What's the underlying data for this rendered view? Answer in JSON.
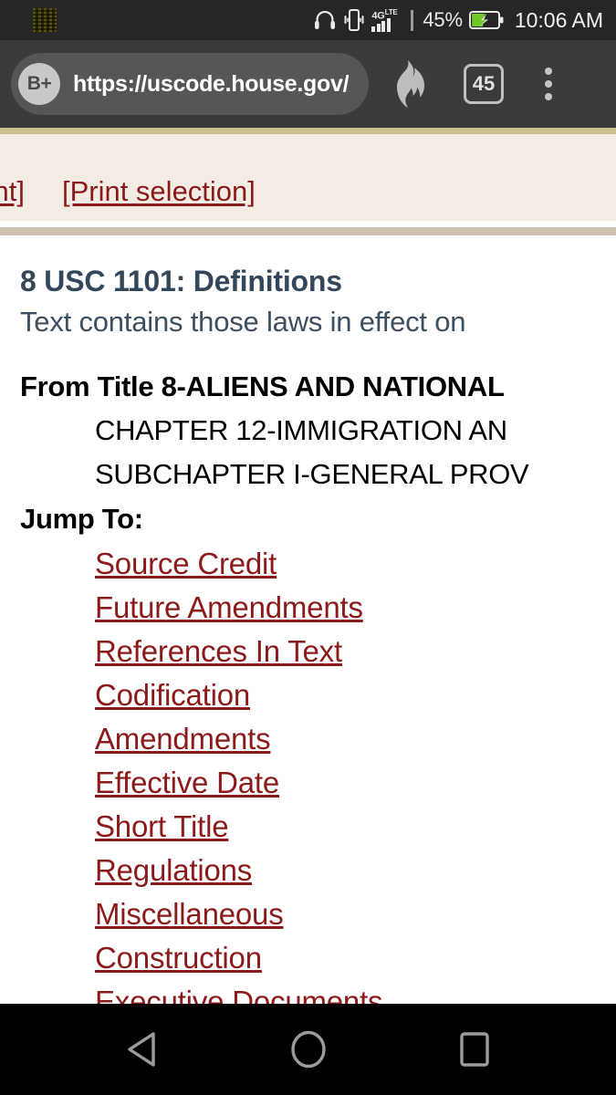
{
  "status_bar": {
    "notification_icon": "app-notification-icon",
    "headphones_icon": "headphones-icon",
    "vibrate_icon": "vibrate-icon",
    "network_label": "4G",
    "network_sup": "LTE",
    "battery_percent": "45%",
    "battery_icon": "battery-charging-icon",
    "clock": "10:06 AM"
  },
  "browser": {
    "bat_badge": "B+",
    "url": "https://uscode.house.gov/",
    "shields_icon": "brave-shields-flame-icon",
    "tab_count": "45",
    "menu_icon": "overflow-menu-icon"
  },
  "page": {
    "print_links": [
      {
        "label": "[Print]"
      },
      {
        "label": "[Print selection]"
      }
    ],
    "doc_title": "8 USC 1101: Definitions",
    "doc_subtitle": "Text contains those laws in effect on",
    "from_title": "From Title 8-ALIENS AND NATIONAL",
    "chapter": "CHAPTER 12-IMMIGRATION AN",
    "subchapter": "SUBCHAPTER I-GENERAL PROV",
    "jump_to_label": "Jump To:",
    "jump_links": [
      {
        "label": "Source Credit"
      },
      {
        "label": "Future Amendments"
      },
      {
        "label": "References In Text"
      },
      {
        "label": "Codification"
      },
      {
        "label": "Amendments"
      },
      {
        "label": "Effective Date"
      },
      {
        "label": "Short Title"
      },
      {
        "label": "Regulations"
      },
      {
        "label": "Miscellaneous"
      },
      {
        "label": "Construction"
      },
      {
        "label": "Executive Documents"
      }
    ]
  },
  "nav_bar": {
    "back_icon": "back-triangle-icon",
    "home_icon": "home-circle-icon",
    "recents_icon": "recents-square-icon"
  },
  "colors": {
    "status_bar_bg": "#262626",
    "toolbar_bg": "#3b3b3b",
    "omnibox_bg": "#565656",
    "banner_bg": "#f3ece4",
    "khaki_strip": "#cbbf93",
    "tan_rule": "#cfc1b2",
    "link_red": "#8b1a1a",
    "title_slate": "#33475b",
    "nav_bar_bg": "#000000"
  }
}
